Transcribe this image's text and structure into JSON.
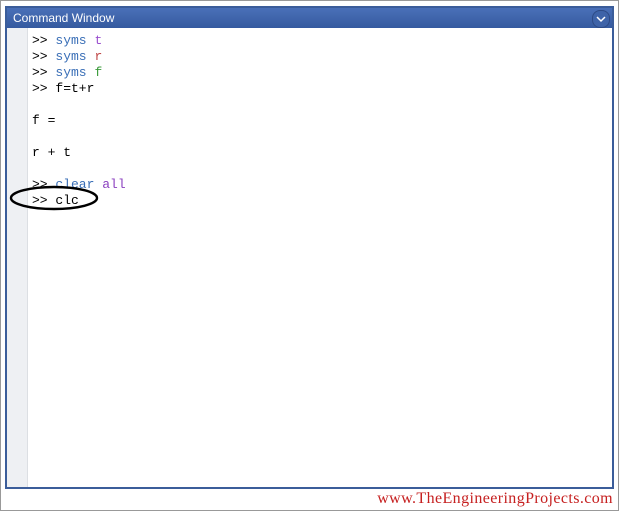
{
  "titlebar": {
    "title": "Command Window",
    "dropdown_icon": "chevron-down"
  },
  "code": {
    "prompt": ">> ",
    "lines": [
      {
        "kind": "cmd_syms",
        "kw": "syms",
        "arg": "t",
        "argClass": "sym-t"
      },
      {
        "kind": "cmd_syms",
        "kw": "syms",
        "arg": "r",
        "argClass": "sym-r"
      },
      {
        "kind": "cmd_syms",
        "kw": "syms",
        "arg": "f",
        "argClass": "sym-f"
      },
      {
        "kind": "cmd_plain",
        "text": "f=t+r"
      },
      {
        "kind": "blank"
      },
      {
        "kind": "out",
        "text": "f ="
      },
      {
        "kind": "blank"
      },
      {
        "kind": "out",
        "text": "r + t"
      },
      {
        "kind": "blank"
      },
      {
        "kind": "cmd_clear",
        "kw": "clear",
        "arg": "all"
      },
      {
        "kind": "cmd_plain",
        "text": "clc"
      }
    ]
  },
  "annotation": {
    "circled_text": "clc"
  },
  "watermark": {
    "text": "www.TheEngineeringProjects.com"
  }
}
